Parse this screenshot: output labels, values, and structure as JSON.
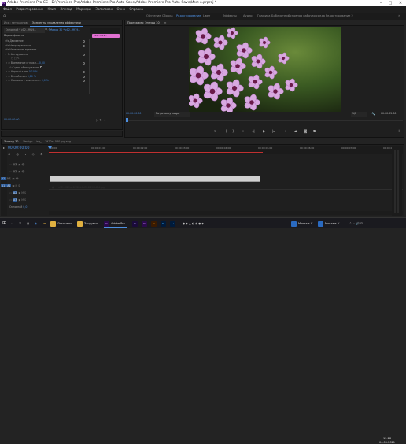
{
  "window": {
    "title": "Adobe Premiere Pro CC - D:\\Premiere Pro\\Adobe Premiere Pro Auto-Save\\Adobe Premiere Pro Auto-Save\\Имя о.prproj *",
    "minimize": "–",
    "maximize": "□",
    "close": "✕"
  },
  "menu": [
    "Файл",
    "Редактирование",
    "Клип",
    "Эпизод",
    "Маркеры",
    "Заголовок",
    "Окно",
    "Справка"
  ],
  "workspaces": {
    "items": [
      "Обучение",
      "Сборка",
      "Редактирование",
      "Цвет",
      "Эффекты",
      "Аудио",
      "Графика",
      "Библиотеки",
      "Основная рабочая среда",
      "Редактирование 2"
    ],
    "active_index": 2
  },
  "left_panel": {
    "tabs": [
      "Исх.: нет клипов",
      "Элементы управления эффектами",
      "Микшер клипов аудио: Эпизод 30",
      "Мета"
    ],
    "active_tab": 1,
    "source_label": "Основной * v12...fff19...",
    "seq_label": "Эпизод 30 * v12...fff19...",
    "clip_name": "v12...fff19...",
    "section": "Видеоэффекты",
    "effects": [
      {
        "name": "fx  Движение"
      },
      {
        "name": "fx  Непрозрачность"
      },
      {
        "name": "fx  Изменение времени"
      },
      {
        "name": "fx  Автоуровень"
      },
      {
        "name": "Временное сглажи...",
        "value": "0,00"
      },
      {
        "name": "Сцена обнаружения",
        "value": ""
      },
      {
        "name": "Черный клип",
        "value": "0,10 %"
      },
      {
        "name": "Белый клип",
        "value": "0,10 %"
      },
      {
        "name": "Смешать с оригинал...",
        "value": "0,0 %"
      }
    ],
    "timecode": "00:00:00:00"
  },
  "program_monitor": {
    "tab": "Программа: Эпизод 30",
    "timecode_left": "00:00:00:00",
    "fit_label": "По размеру кадра",
    "scale_label": "1/2",
    "timecode_right": "00:00:05:00"
  },
  "timeline": {
    "tabs": [
      "Эпизод 30",
      "Vertigo ...ing_... 1920x1080.jpg.eng"
    ],
    "timecode": "00:00:00:00",
    "ruler": [
      "00:00",
      "00:00:01:00",
      "00:00:02:00",
      "00:00:03:00",
      "00:00:04:00",
      "00:00:05:00",
      "00:00:06:00",
      "00:00:07:00",
      "00:00:08:00"
    ],
    "tracks": [
      {
        "id": "V3",
        "kind": "video"
      },
      {
        "id": "V2",
        "kind": "video"
      },
      {
        "id": "V1",
        "kind": "video"
      },
      {
        "id": "A1",
        "kind": "audio"
      },
      {
        "id": "A2",
        "kind": "audio"
      },
      {
        "id": "A3",
        "kind": "audio"
      }
    ],
    "master_label": "Основной",
    "master_value": "0,0",
    "clip_label": "v12...f8ffae4fff8eb0d3e8f200424.jpg"
  },
  "taskbar": {
    "items": [
      {
        "label": "Логотипы",
        "color": "#e0b040"
      },
      {
        "label": "Загрузки",
        "color": "#e0b040"
      },
      {
        "label": "Adobe Pre...",
        "color": "#2a0a4a"
      },
      {
        "label": "Moнтаж V...",
        "color": "#2a6ac0"
      },
      {
        "label": "Monтаж V...",
        "color": "#2a6ac0"
      }
    ],
    "icons": [
      "Ae",
      "Pr",
      "Ai",
      "Ps",
      "Lr"
    ],
    "time": "19:28",
    "date": "04.05.2021"
  },
  "colors": {
    "accent": "#4d8fe0",
    "clip_pink": "#e070d0",
    "playhead": "#4d8fe0"
  }
}
